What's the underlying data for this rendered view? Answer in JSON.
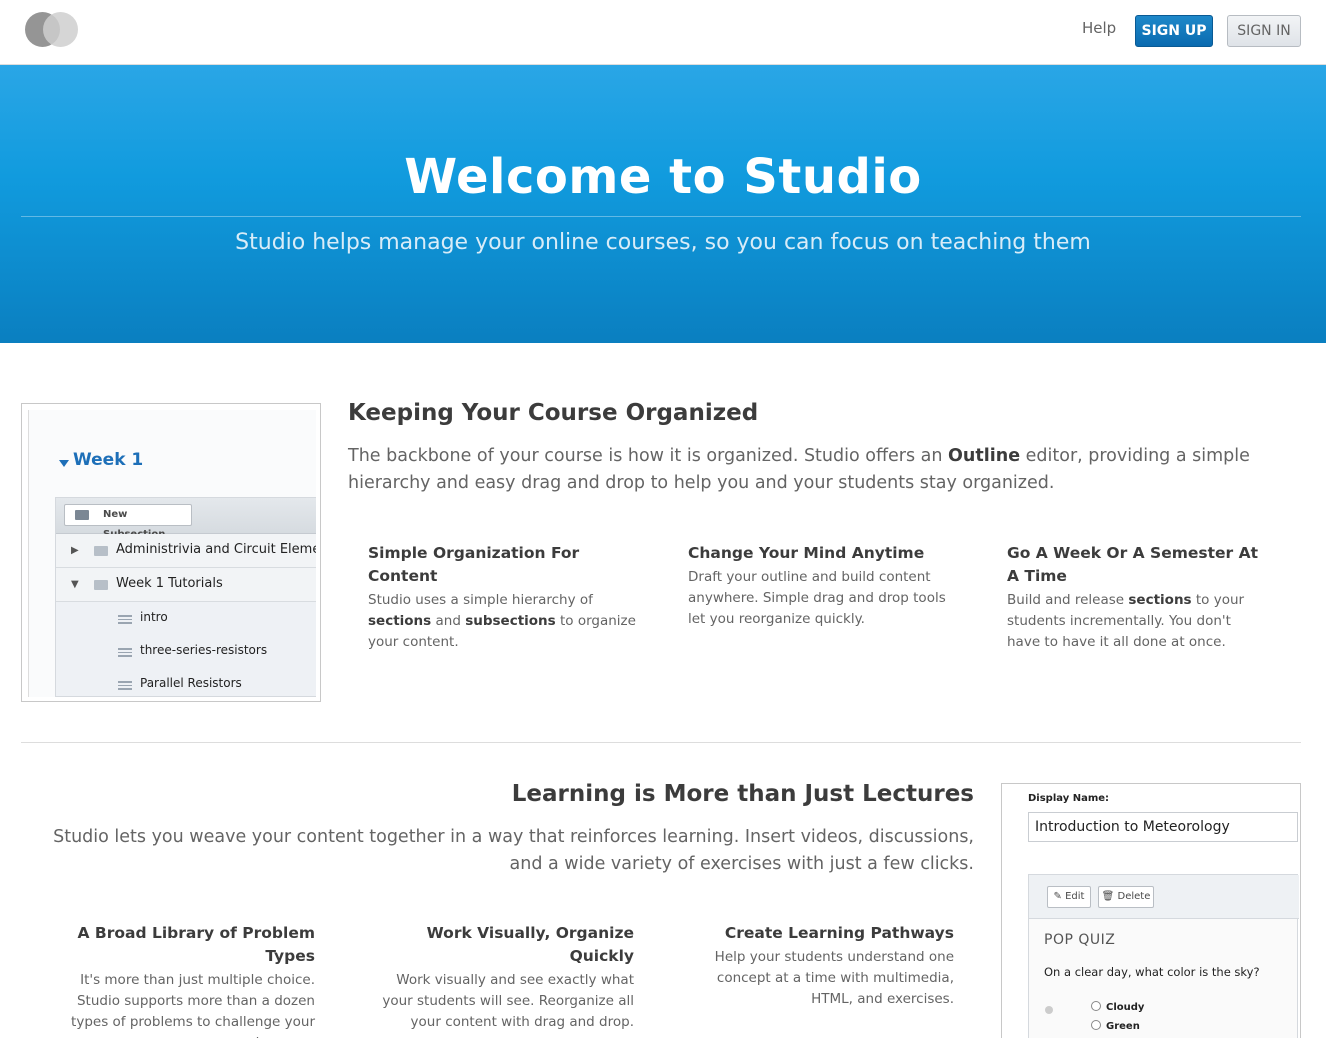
{
  "header": {
    "help_label": "Help",
    "signup_label": "SIGN UP",
    "signin_label": "SIGN IN"
  },
  "hero": {
    "title": "Welcome to Studio",
    "subtitle": "Studio helps manage your online courses, so you can focus on teaching them"
  },
  "section_organized": {
    "title": "Keeping Your Course Organized",
    "desc_before": "The backbone of your course is how it is organized. Studio offers an ",
    "desc_bold": "Outline",
    "desc_after": " editor, providing a simple hierarchy and easy drag and drop to help you and your students stay organized.",
    "screenshot": {
      "week": "Week 1",
      "new_subsection": "New Subsection",
      "rows": [
        "Administrivia and Circuit Eleme",
        "Week 1 Tutorials",
        "intro",
        "three-series-resistors",
        "Parallel Resistors"
      ]
    },
    "features": [
      {
        "title": "Simple Organization For Content",
        "t1": "Studio uses a simple hierarchy of ",
        "b1": "sections",
        "t2": " and ",
        "b2": "subsections",
        "t3": " to organize your content."
      },
      {
        "title": "Change Your Mind Anytime",
        "text": "Draft your outline and build content anywhere. Simple drag and drop tools let you reorganize quickly."
      },
      {
        "title": "Go A Week Or A Semester At A Time",
        "t1": "Build and release ",
        "b1": "sections",
        "t2": " to your students incrementally. You don't have to have it all done at once."
      }
    ]
  },
  "section_learning": {
    "title": "Learning is More than Just Lectures",
    "desc": "Studio lets you weave your content together in a way that reinforces learning. Insert videos, discussions, and a wide variety of exercises with just a few clicks.",
    "features": [
      {
        "title": "A Broad Library of Problem Types",
        "text": "It's more than just multiple choice. Studio supports more than a dozen types of problems to challenge your learners."
      },
      {
        "title": "Work Visually, Organize Quickly",
        "text": "Work visually and see exactly what your students will see. Reorganize all your content with drag and drop."
      },
      {
        "title": "Create Learning Pathways",
        "text": "Help your students understand one concept at a time with multimedia, HTML, and exercises."
      }
    ],
    "screenshot": {
      "display_name_label": "Display Name:",
      "display_name_value": "Introduction to Meteorology",
      "edit_label": "Edit",
      "delete_label": "Delete",
      "quiz_title": "POP QUIZ",
      "question": "On a clear day, what color is the sky?",
      "options": [
        "Cloudy",
        "Green"
      ]
    }
  },
  "colors": {
    "hero_top": "#2aa6e6",
    "hero_bottom": "#0a7fc0",
    "signup_bg": "#1e88c9",
    "link_blue": "#1d6fb8"
  }
}
